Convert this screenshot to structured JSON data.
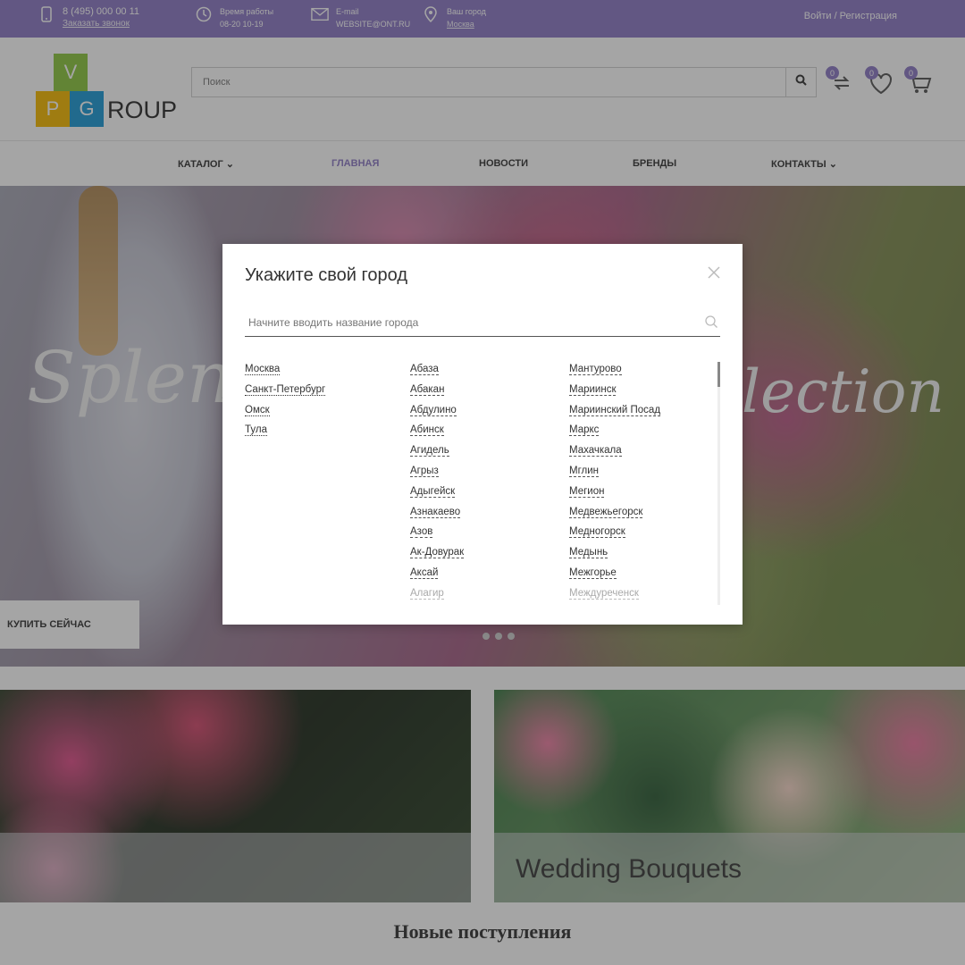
{
  "topbar": {
    "phone": "8 (495) 000 00 11",
    "callback": "Заказать звонок",
    "hours_label": "Время работы",
    "hours_value": "08-20 10-19",
    "email_label": "E-mail",
    "email_value": "WEBSITE@ONT.RU",
    "city_label": "Ваш город",
    "city_value": "Москва",
    "login": "Войти / Регистрация"
  },
  "header": {
    "logo": {
      "v": "V",
      "p": "P",
      "g": "G",
      "roup": "ROUP"
    },
    "search_placeholder": "Поиск",
    "compare_count": "0",
    "wishlist_count": "0",
    "cart_count": "0"
  },
  "nav": {
    "items": [
      {
        "label": "КАТАЛОГ",
        "active": false,
        "dropdown": true
      },
      {
        "label": "ГЛАВНАЯ",
        "active": true,
        "dropdown": false
      },
      {
        "label": "НОВОСТИ",
        "active": false,
        "dropdown": false
      },
      {
        "label": "БРЕНДЫ",
        "active": false,
        "dropdown": false
      },
      {
        "label": "КОНТАКТЫ",
        "active": false,
        "dropdown": true
      }
    ]
  },
  "hero": {
    "text_left": "Splen",
    "text_right": "lection",
    "buy_button": "КУПИТЬ СЕЙЧАС"
  },
  "banners": [
    {
      "caption": ""
    },
    {
      "caption": "Wedding Bouquets"
    }
  ],
  "section_title": "Новые поступления",
  "modal": {
    "title": "Укажите свой город",
    "search_placeholder": "Начните вводить название города",
    "popular_cities": [
      "Москва",
      "Санкт-Петербург",
      "Омск",
      "Тула"
    ],
    "cities_col2": [
      "Абаза",
      "Абакан",
      "Абдулино",
      "Абинск",
      "Агидель",
      "Агрыз",
      "Адыгейск",
      "Азнакаево",
      "Азов",
      "Ак-Довурак",
      "Аксай",
      "Алагир"
    ],
    "cities_col3": [
      "Мантурово",
      "Мариинск",
      "Мариинский Посад",
      "Маркс",
      "Махачкала",
      "Мглин",
      "Мегион",
      "Медвежьегорск",
      "Медногорск",
      "Медынь",
      "Межгорье",
      "Междуреченск"
    ]
  },
  "colors": {
    "accent": "#8c79c4",
    "logo_green": "#8cc63f",
    "logo_yellow": "#f5b800",
    "logo_blue": "#1d9ad6"
  }
}
